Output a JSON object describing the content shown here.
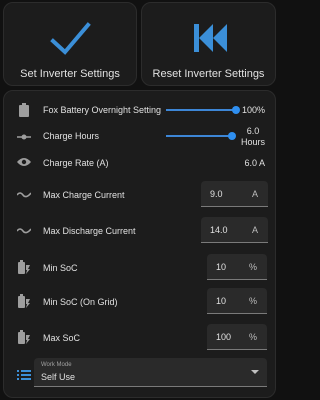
{
  "buttons": {
    "set_label": "Set Inverter Settings",
    "reset_label": "Reset Inverter Settings",
    "accent": "#3b8fd8"
  },
  "entities": [
    {
      "id": "battery",
      "label": "Fox Battery Overnight Setting",
      "value": "100%",
      "level": 1.0
    },
    {
      "id": "charge-hours",
      "label": "Charge Hours",
      "value_line1": "6.0",
      "value_line2": "Hours",
      "level": 0.95
    },
    {
      "id": "charge-rate",
      "label": "Charge Rate (A)",
      "value": "6.0 A"
    },
    {
      "id": "max-charge",
      "label": "Max Charge Current",
      "value": "9.0",
      "unit": "A"
    },
    {
      "id": "max-discharge",
      "label": "Max Discharge Current",
      "value": "14.0",
      "unit": "A"
    },
    {
      "id": "min-soc",
      "label": "Min SoC",
      "value": "10",
      "unit": "%"
    },
    {
      "id": "min-soc-grid",
      "label": "Min SoC (On Grid)",
      "value": "10",
      "unit": "%"
    },
    {
      "id": "max-soc",
      "label": "Max SoC",
      "value": "100",
      "unit": "%"
    }
  ],
  "work_mode": {
    "caption": "Work Mode",
    "value": "Self Use"
  }
}
